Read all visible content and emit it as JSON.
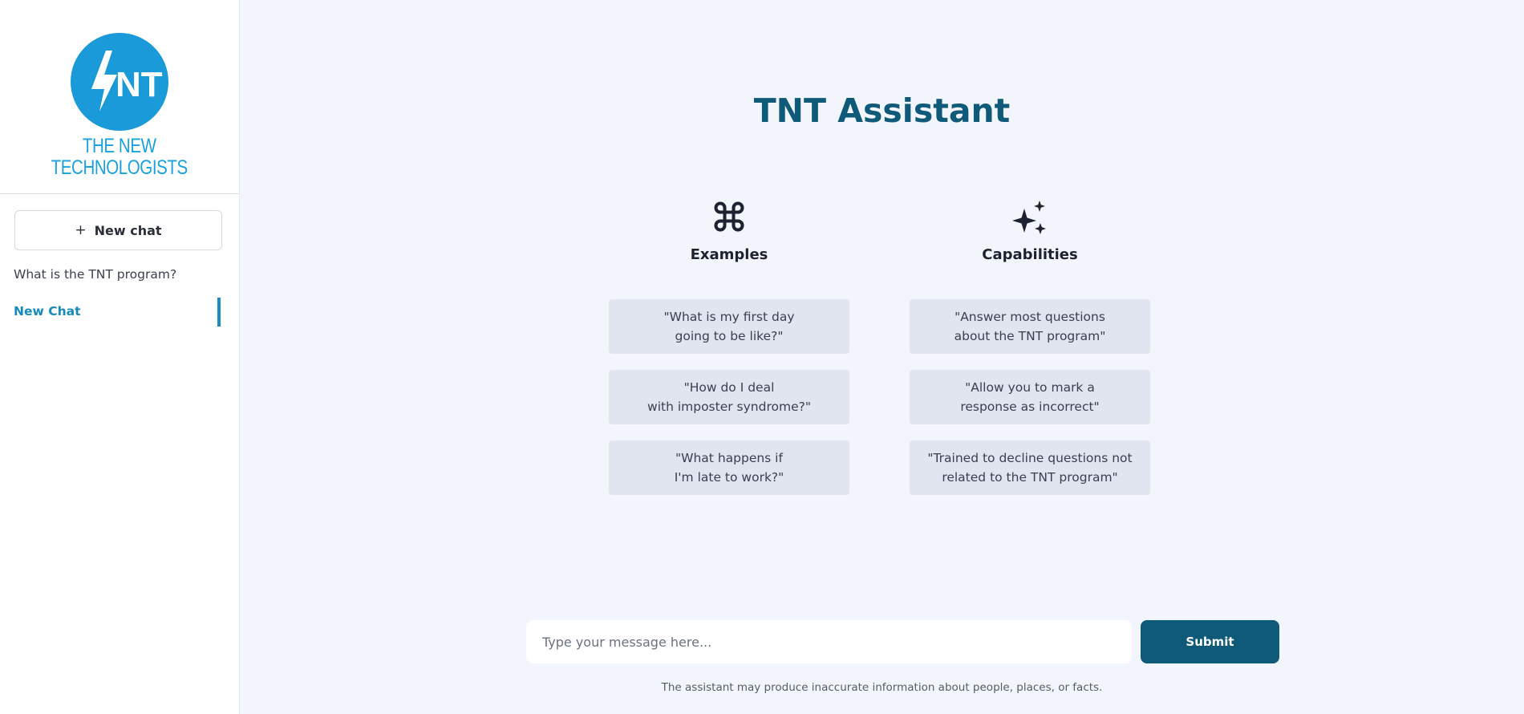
{
  "sidebar": {
    "brand": {
      "line1": "THE NEW",
      "line2": "TECHNOLOGISTS",
      "color": "#1aa1e0"
    },
    "new_chat": {
      "icon": "+",
      "label": "New chat"
    },
    "history": [
      {
        "label": "What is the TNT program?"
      },
      {
        "label": "New Chat"
      }
    ]
  },
  "main": {
    "title": "TNT Assistant",
    "examples": {
      "icon": "command-icon",
      "heading": "Examples",
      "items": [
        "\"What is my first day\ngoing to be like?\"",
        "\"How do I deal\nwith imposter syndrome?\"",
        "\"What happens if\nI'm late to work?\""
      ]
    },
    "capabilities": {
      "icon": "sparkles-icon",
      "heading": "Capabilities",
      "items": [
        "\"Answer most questions\nabout the TNT program\"",
        "\"Allow you to mark a\nresponse as incorrect\"",
        "\"Trained to decline questions not\nrelated to the TNT program\""
      ]
    },
    "composer": {
      "placeholder": "Type your message here...",
      "submit_label": "Submit"
    },
    "disclaimer": "The assistant may produce inaccurate information about people, places, or facts."
  },
  "colors": {
    "accent": "#0e5a78",
    "brand": "#1aa1e0",
    "active": "#1689bd",
    "card_bg": "#e0e5ef",
    "page_bg": "#f2f5fb"
  }
}
